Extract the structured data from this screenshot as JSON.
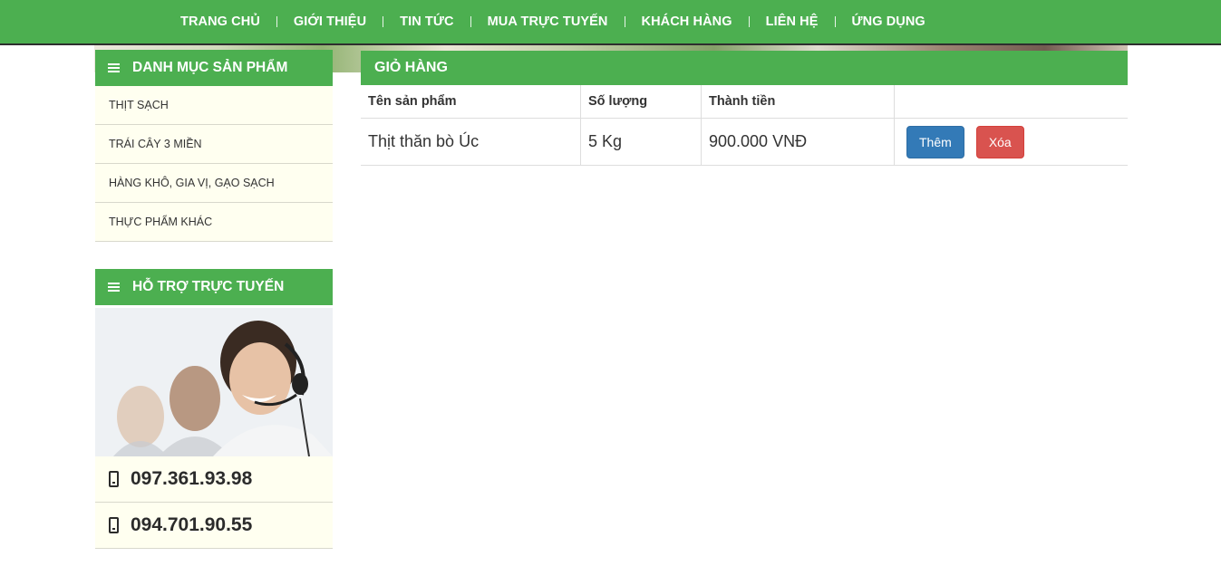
{
  "nav": {
    "items": [
      "TRANG CHỦ",
      "GIỚI THIỆU",
      "TIN TỨC",
      "MUA TRỰC TUYẾN",
      "KHÁCH HÀNG",
      "LIÊN HỆ",
      "ỨNG DỤNG"
    ]
  },
  "sidebar": {
    "categories_title": "DANH MỤC SẢN PHẨM",
    "categories": [
      "THỊT SẠCH",
      "TRÁI CÂY 3 MIỀN",
      "HÀNG KHÔ, GIA VỊ, GẠO SẠCH",
      "THỰC PHẨM KHÁC"
    ],
    "support_title": "HỖ TRỢ TRỰC TUYẾN",
    "phones": [
      "097.361.93.98",
      "094.701.90.55"
    ]
  },
  "cart": {
    "title": "GIỎ HÀNG",
    "columns": [
      "Tên sản phẩm",
      "Số lượng",
      "Thành tiền",
      ""
    ],
    "rows": [
      {
        "name": "Thịt thăn bò Úc",
        "quantity": "5 Kg",
        "total": "900.000 VNĐ",
        "add_label": "Thêm",
        "delete_label": "Xóa"
      }
    ]
  },
  "colors": {
    "brand_green": "#4caf50",
    "add_button": "#337ab7",
    "delete_button": "#d9534f",
    "sidebar_bg": "#fffff0"
  }
}
